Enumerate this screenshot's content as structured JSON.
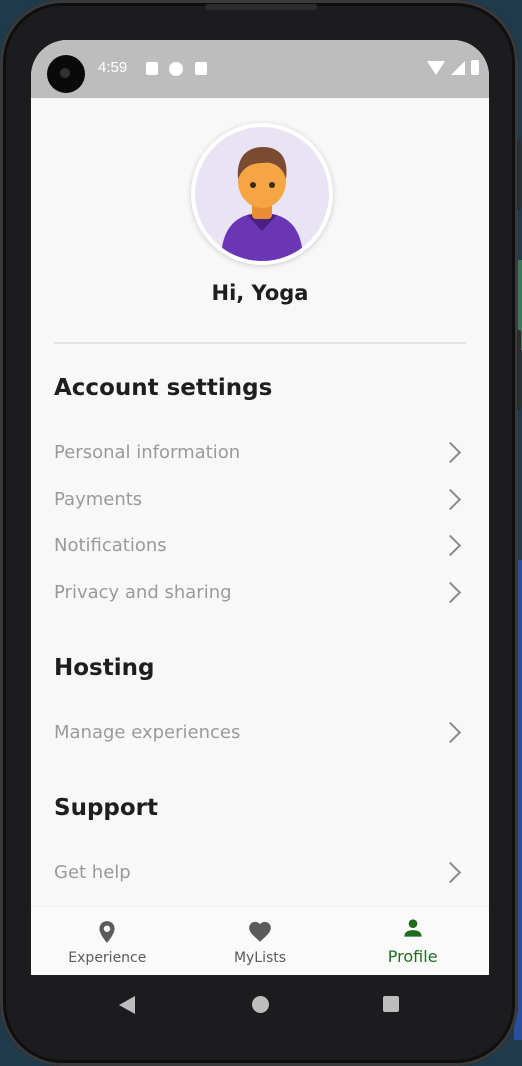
{
  "status_bar": {
    "time": "4:59"
  },
  "profile": {
    "greeting": "Hi, Yoga"
  },
  "sections": {
    "account": {
      "title": "Account settings",
      "items": [
        {
          "label": "Personal information"
        },
        {
          "label": "Payments"
        },
        {
          "label": "Notifications"
        },
        {
          "label": "Privacy and sharing"
        }
      ]
    },
    "hosting": {
      "title": "Hosting",
      "items": [
        {
          "label": "Manage experiences"
        }
      ]
    },
    "support": {
      "title": "Support",
      "items": [
        {
          "label": "Get help"
        }
      ]
    }
  },
  "bottom_nav": {
    "items": [
      {
        "label": "Experience",
        "icon": "location-pin-icon"
      },
      {
        "label": "MyLists",
        "icon": "heart-icon"
      },
      {
        "label": "Profile",
        "icon": "person-icon"
      }
    ],
    "active_index": 2
  },
  "colors": {
    "active": "#1f6b1f",
    "inactive": "#5b5b5b",
    "avatar_bg": "#e9e4f3"
  }
}
